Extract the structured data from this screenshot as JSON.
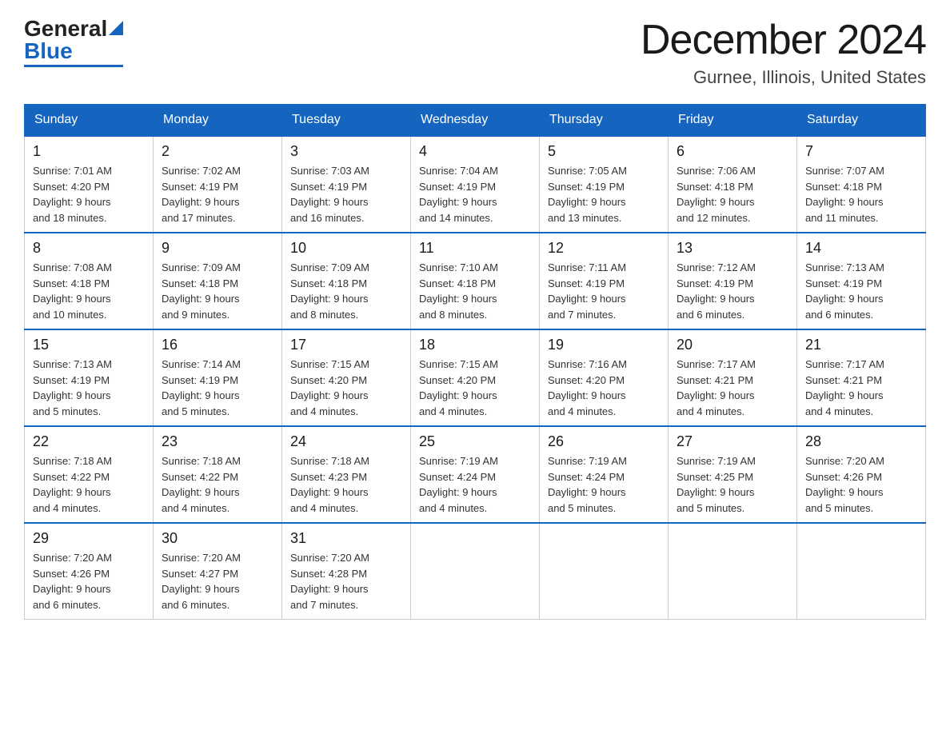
{
  "header": {
    "logo_general": "General",
    "logo_triangle": "▶",
    "logo_blue": "Blue",
    "month_title": "December 2024",
    "location": "Gurnee, Illinois, United States"
  },
  "weekdays": [
    "Sunday",
    "Monday",
    "Tuesday",
    "Wednesday",
    "Thursday",
    "Friday",
    "Saturday"
  ],
  "weeks": [
    [
      {
        "day": "1",
        "sunrise": "7:01 AM",
        "sunset": "4:20 PM",
        "daylight": "9 hours and 18 minutes."
      },
      {
        "day": "2",
        "sunrise": "7:02 AM",
        "sunset": "4:19 PM",
        "daylight": "9 hours and 17 minutes."
      },
      {
        "day": "3",
        "sunrise": "7:03 AM",
        "sunset": "4:19 PM",
        "daylight": "9 hours and 16 minutes."
      },
      {
        "day": "4",
        "sunrise": "7:04 AM",
        "sunset": "4:19 PM",
        "daylight": "9 hours and 14 minutes."
      },
      {
        "day": "5",
        "sunrise": "7:05 AM",
        "sunset": "4:19 PM",
        "daylight": "9 hours and 13 minutes."
      },
      {
        "day": "6",
        "sunrise": "7:06 AM",
        "sunset": "4:18 PM",
        "daylight": "9 hours and 12 minutes."
      },
      {
        "day": "7",
        "sunrise": "7:07 AM",
        "sunset": "4:18 PM",
        "daylight": "9 hours and 11 minutes."
      }
    ],
    [
      {
        "day": "8",
        "sunrise": "7:08 AM",
        "sunset": "4:18 PM",
        "daylight": "9 hours and 10 minutes."
      },
      {
        "day": "9",
        "sunrise": "7:09 AM",
        "sunset": "4:18 PM",
        "daylight": "9 hours and 9 minutes."
      },
      {
        "day": "10",
        "sunrise": "7:09 AM",
        "sunset": "4:18 PM",
        "daylight": "9 hours and 8 minutes."
      },
      {
        "day": "11",
        "sunrise": "7:10 AM",
        "sunset": "4:18 PM",
        "daylight": "9 hours and 8 minutes."
      },
      {
        "day": "12",
        "sunrise": "7:11 AM",
        "sunset": "4:19 PM",
        "daylight": "9 hours and 7 minutes."
      },
      {
        "day": "13",
        "sunrise": "7:12 AM",
        "sunset": "4:19 PM",
        "daylight": "9 hours and 6 minutes."
      },
      {
        "day": "14",
        "sunrise": "7:13 AM",
        "sunset": "4:19 PM",
        "daylight": "9 hours and 6 minutes."
      }
    ],
    [
      {
        "day": "15",
        "sunrise": "7:13 AM",
        "sunset": "4:19 PM",
        "daylight": "9 hours and 5 minutes."
      },
      {
        "day": "16",
        "sunrise": "7:14 AM",
        "sunset": "4:19 PM",
        "daylight": "9 hours and 5 minutes."
      },
      {
        "day": "17",
        "sunrise": "7:15 AM",
        "sunset": "4:20 PM",
        "daylight": "9 hours and 4 minutes."
      },
      {
        "day": "18",
        "sunrise": "7:15 AM",
        "sunset": "4:20 PM",
        "daylight": "9 hours and 4 minutes."
      },
      {
        "day": "19",
        "sunrise": "7:16 AM",
        "sunset": "4:20 PM",
        "daylight": "9 hours and 4 minutes."
      },
      {
        "day": "20",
        "sunrise": "7:17 AM",
        "sunset": "4:21 PM",
        "daylight": "9 hours and 4 minutes."
      },
      {
        "day": "21",
        "sunrise": "7:17 AM",
        "sunset": "4:21 PM",
        "daylight": "9 hours and 4 minutes."
      }
    ],
    [
      {
        "day": "22",
        "sunrise": "7:18 AM",
        "sunset": "4:22 PM",
        "daylight": "9 hours and 4 minutes."
      },
      {
        "day": "23",
        "sunrise": "7:18 AM",
        "sunset": "4:22 PM",
        "daylight": "9 hours and 4 minutes."
      },
      {
        "day": "24",
        "sunrise": "7:18 AM",
        "sunset": "4:23 PM",
        "daylight": "9 hours and 4 minutes."
      },
      {
        "day": "25",
        "sunrise": "7:19 AM",
        "sunset": "4:24 PM",
        "daylight": "9 hours and 4 minutes."
      },
      {
        "day": "26",
        "sunrise": "7:19 AM",
        "sunset": "4:24 PM",
        "daylight": "9 hours and 5 minutes."
      },
      {
        "day": "27",
        "sunrise": "7:19 AM",
        "sunset": "4:25 PM",
        "daylight": "9 hours and 5 minutes."
      },
      {
        "day": "28",
        "sunrise": "7:20 AM",
        "sunset": "4:26 PM",
        "daylight": "9 hours and 5 minutes."
      }
    ],
    [
      {
        "day": "29",
        "sunrise": "7:20 AM",
        "sunset": "4:26 PM",
        "daylight": "9 hours and 6 minutes."
      },
      {
        "day": "30",
        "sunrise": "7:20 AM",
        "sunset": "4:27 PM",
        "daylight": "9 hours and 6 minutes."
      },
      {
        "day": "31",
        "sunrise": "7:20 AM",
        "sunset": "4:28 PM",
        "daylight": "9 hours and 7 minutes."
      },
      null,
      null,
      null,
      null
    ]
  ]
}
